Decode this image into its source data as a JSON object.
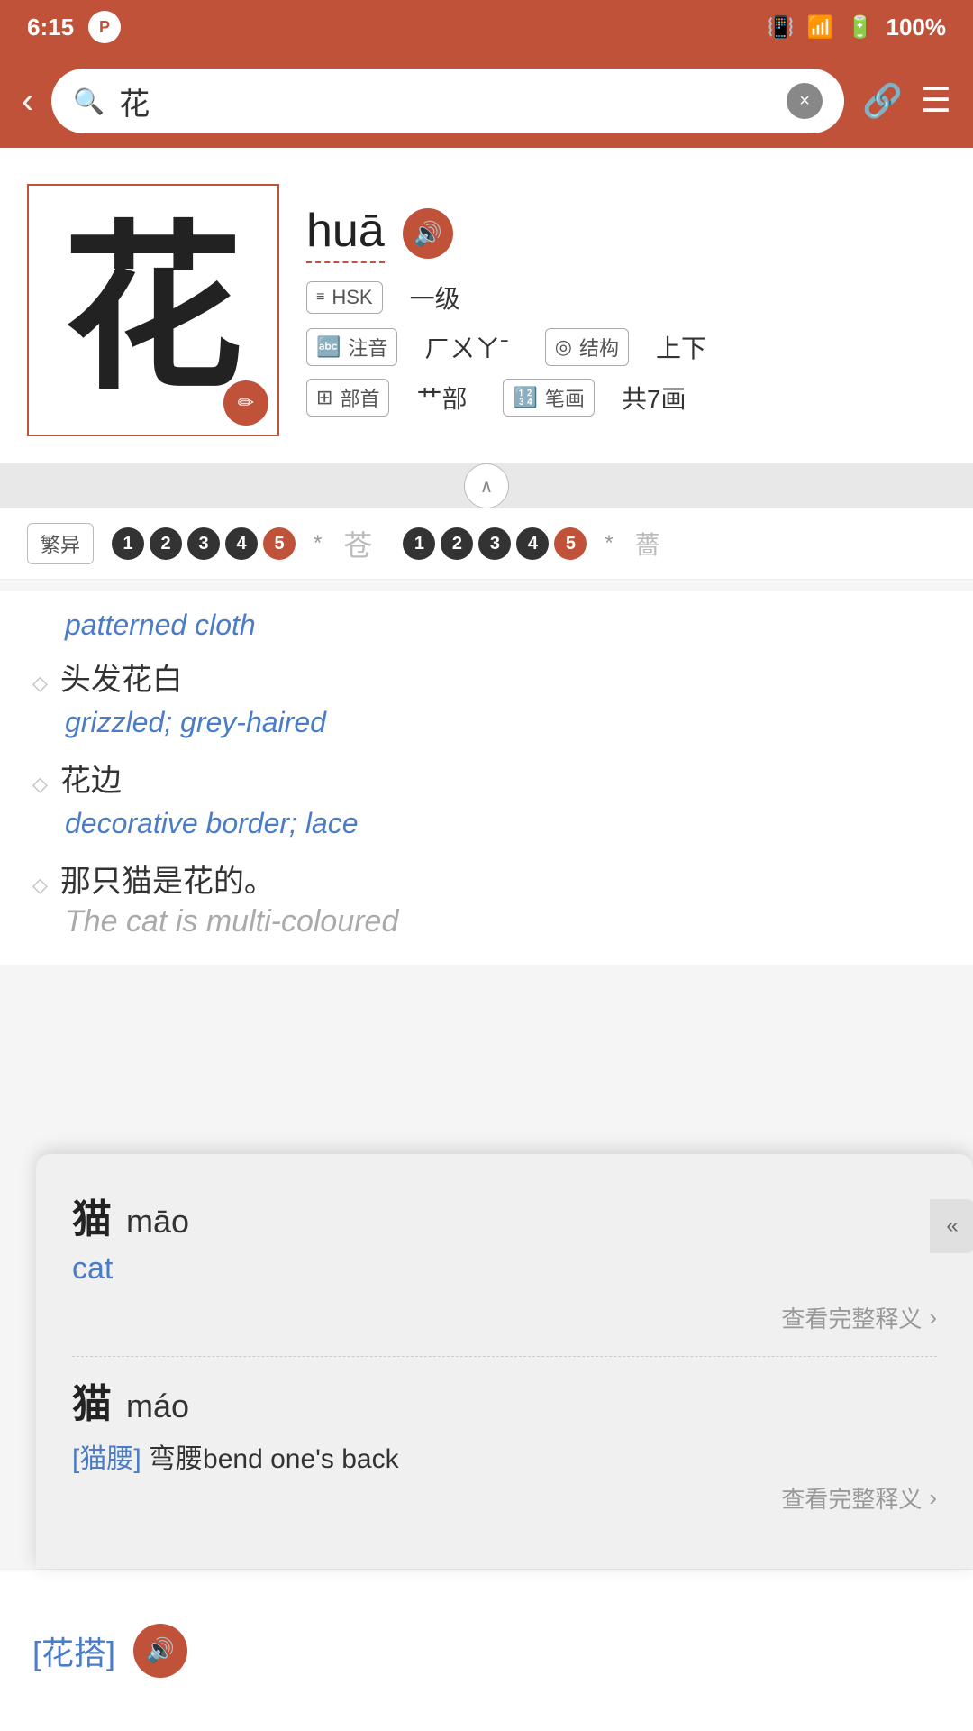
{
  "statusBar": {
    "time": "6:15",
    "battery": "100%"
  },
  "header": {
    "backLabel": "‹",
    "searchValue": "花",
    "clearLabel": "×",
    "linkIcon": "🔗",
    "menuIcon": "≡"
  },
  "character": {
    "char": "花",
    "pinyin": "huā",
    "hskLabel": "HSK",
    "hskLevel": "一级",
    "pronunciationLabel": "注音",
    "pronunciationValue": "ㄏㄨㄚˉ",
    "structureLabel": "结构",
    "structureValue": "上下",
    "radicalLabel": "部首",
    "radicalValue": "艹部",
    "strokesLabel": "笔画",
    "strokesValue": "共7画",
    "editIcon": "✎"
  },
  "variants": {
    "label": "繁异",
    "strokes1": [
      "1",
      "2",
      "3",
      "4",
      "5"
    ],
    "char1": "苍",
    "strokes2": [
      "1",
      "2",
      "3",
      "4",
      "5"
    ],
    "char2": "薔"
  },
  "definitions": [
    {
      "type": "patterned",
      "english": "patterned cloth"
    },
    {
      "type": "phrase",
      "chinese": "头发花白",
      "english": "grizzled; grey-haired"
    },
    {
      "type": "phrase",
      "chinese": "花边",
      "english": "decorative border; lace"
    },
    {
      "type": "sentence",
      "chinese": "那只猫是花的。",
      "english": "The cat is multi-coloured"
    }
  ],
  "popup": {
    "closeIcon": "«",
    "entries": [
      {
        "char": "猫",
        "pinyin": "māo",
        "meaning": "cat",
        "linkLabel": "查看完整释义",
        "linkArrow": "›"
      },
      {
        "char": "猫",
        "pinyin": "máo",
        "compoundLabel": "[猫腰]",
        "compoundText": "弯腰bend one's back",
        "linkLabel": "查看完整释义",
        "linkArrow": "›"
      }
    ]
  },
  "bottomBar": {
    "linkText": "[花搭]",
    "soundIcon": "🔊"
  }
}
